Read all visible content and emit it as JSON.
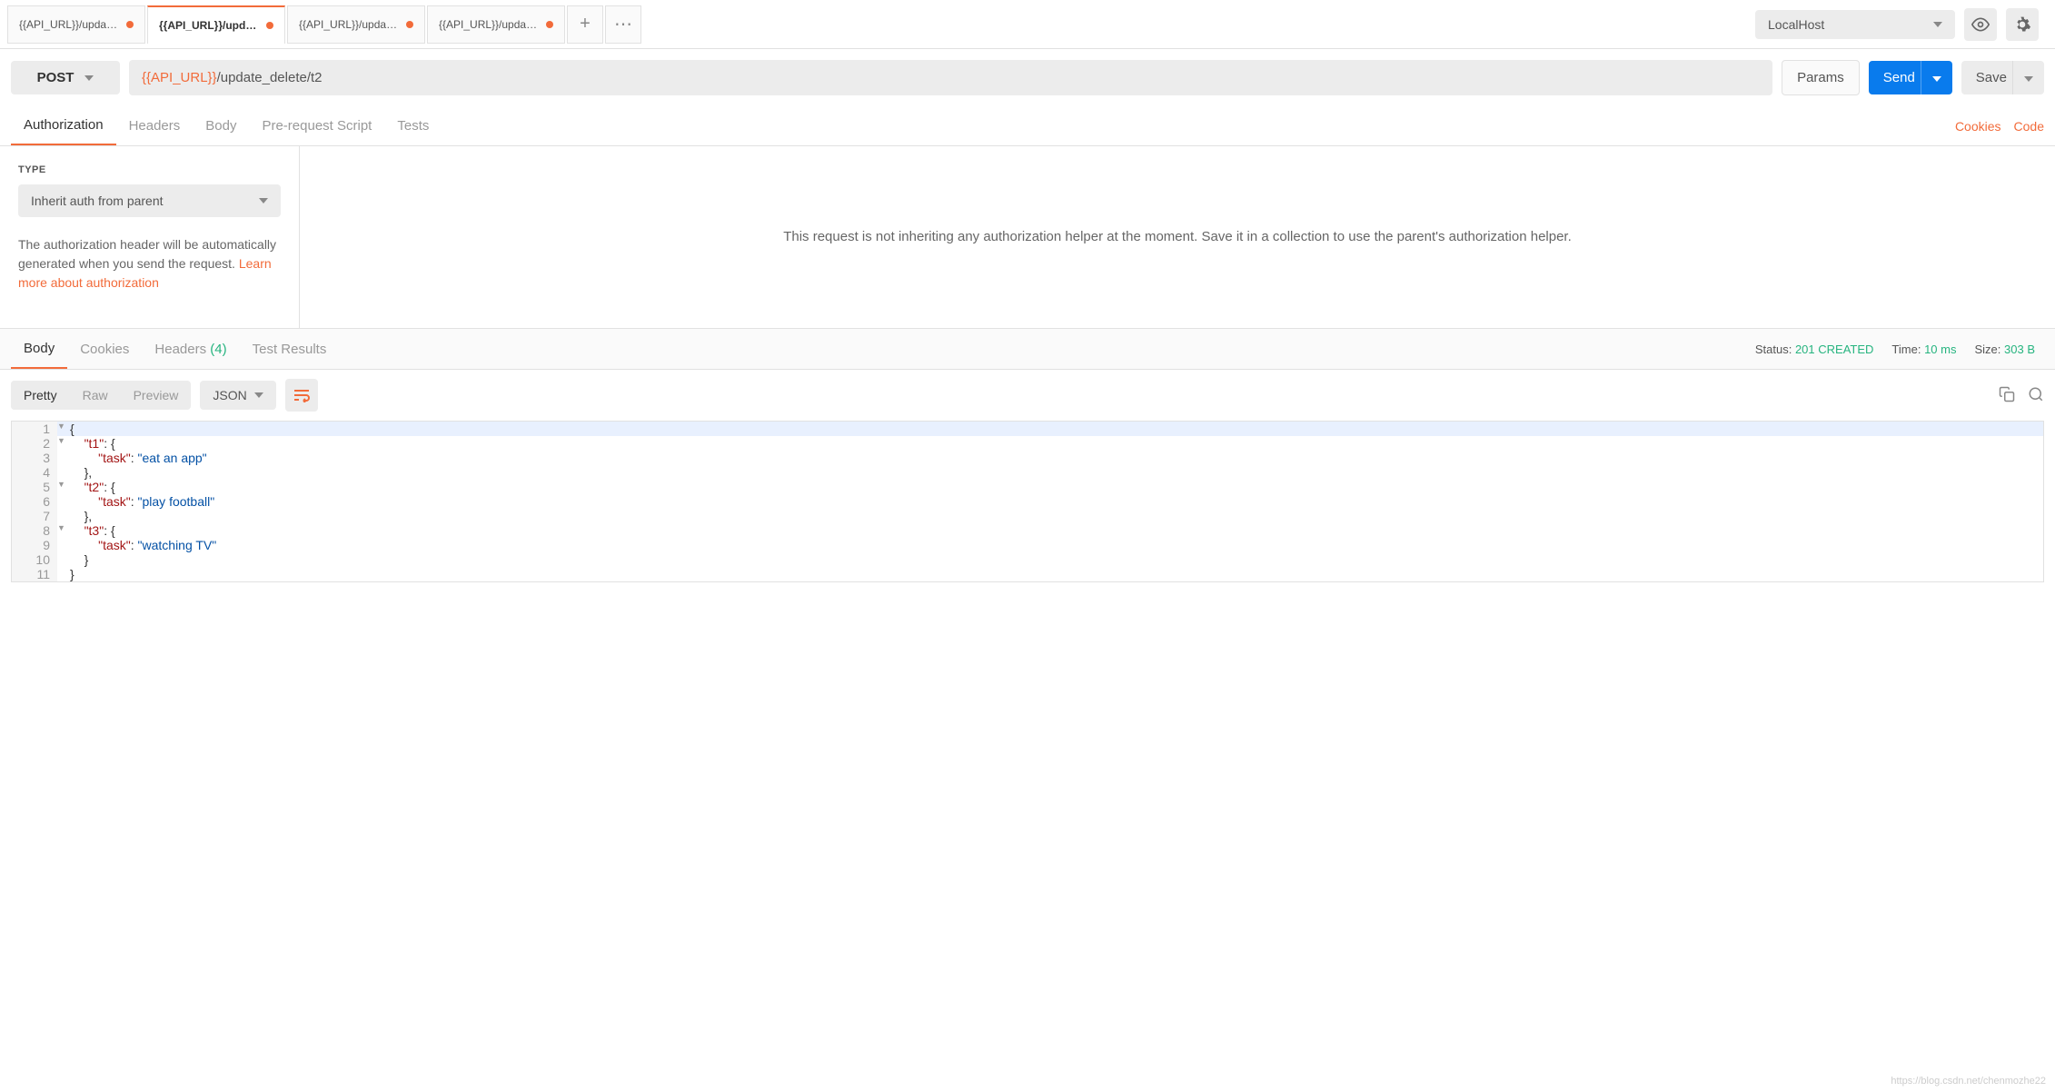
{
  "topbar": {
    "tabs": [
      {
        "label": "{{API_URL}}/update_d"
      },
      {
        "label": "{{API_URL}}/update_d"
      },
      {
        "label": "{{API_URL}}/update_d"
      },
      {
        "label": "{{API_URL}}/update_d"
      }
    ],
    "env_label": "LocalHost"
  },
  "request": {
    "method": "POST",
    "url_var": "{{API_URL}}",
    "url_path": "/update_delete/t2",
    "params_label": "Params",
    "send_label": "Send",
    "save_label": "Save"
  },
  "req_tabs": {
    "authorization": "Authorization",
    "headers": "Headers",
    "body": "Body",
    "prerequest": "Pre-request Script",
    "tests": "Tests",
    "cookies_link": "Cookies",
    "code_link": "Code"
  },
  "auth": {
    "type_label": "TYPE",
    "select_value": "Inherit auth from parent",
    "desc_prefix": "The authorization header will be automatically generated when you send the request. ",
    "learn_more": "Learn more about authorization",
    "right_text": "This request is not inheriting any authorization helper at the moment. Save it in a collection to use the parent's authorization helper."
  },
  "resp_tabs": {
    "body": "Body",
    "cookies": "Cookies",
    "headers": "Headers",
    "headers_count": "(4)",
    "test_results": "Test Results"
  },
  "resp_status": {
    "status_label": "Status:",
    "status_value": "201 CREATED",
    "time_label": "Time:",
    "time_value": "10 ms",
    "size_label": "Size:",
    "size_value": "303 B"
  },
  "resp_toolbar": {
    "pretty": "Pretty",
    "raw": "Raw",
    "preview": "Preview",
    "format": "JSON"
  },
  "code_lines": [
    {
      "n": 1,
      "fold": "▼",
      "html": "<span class='tok-brace'>{</span>"
    },
    {
      "n": 2,
      "fold": "▼",
      "html": "    <span class='tok-key'>\"t1\"</span><span class='tok-punc'>:</span> <span class='tok-brace'>{</span>"
    },
    {
      "n": 3,
      "fold": "",
      "html": "        <span class='tok-key'>\"task\"</span><span class='tok-punc'>:</span> <span class='tok-str'>\"eat an app\"</span>"
    },
    {
      "n": 4,
      "fold": "",
      "html": "    <span class='tok-brace'>}</span><span class='tok-punc'>,</span>"
    },
    {
      "n": 5,
      "fold": "▼",
      "html": "    <span class='tok-key'>\"t2\"</span><span class='tok-punc'>:</span> <span class='tok-brace'>{</span>"
    },
    {
      "n": 6,
      "fold": "",
      "html": "        <span class='tok-key'>\"task\"</span><span class='tok-punc'>:</span> <span class='tok-str'>\"play football\"</span>"
    },
    {
      "n": 7,
      "fold": "",
      "html": "    <span class='tok-brace'>}</span><span class='tok-punc'>,</span>"
    },
    {
      "n": 8,
      "fold": "▼",
      "html": "    <span class='tok-key'>\"t3\"</span><span class='tok-punc'>:</span> <span class='tok-brace'>{</span>"
    },
    {
      "n": 9,
      "fold": "",
      "html": "        <span class='tok-key'>\"task\"</span><span class='tok-punc'>:</span> <span class='tok-str'>\"watching TV\"</span>"
    },
    {
      "n": 10,
      "fold": "",
      "html": "    <span class='tok-brace'>}</span>"
    },
    {
      "n": 11,
      "fold": "",
      "html": "<span class='tok-brace'>}</span>"
    }
  ],
  "watermark": "https://blog.csdn.net/chenmozhe22"
}
